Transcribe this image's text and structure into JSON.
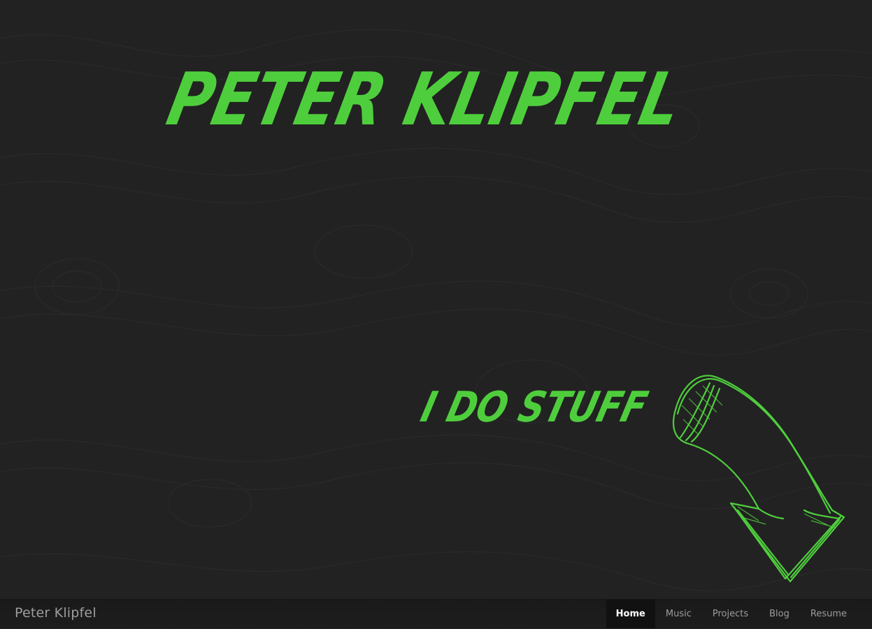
{
  "hero": {
    "title": "PETER KLIPFEL",
    "tagline": "I DO STUFF"
  },
  "colors": {
    "accent": "#4fce3d",
    "background": "#222222",
    "navbar": "#1b1b1b",
    "nav_text": "#9d9d9d",
    "nav_active_text": "#ffffff"
  },
  "icons": {
    "arrow": "hand-drawn-curved-arrow-down"
  },
  "navbar": {
    "brand": "Peter Klipfel",
    "links": [
      {
        "label": "Home",
        "active": true
      },
      {
        "label": "Music",
        "active": false
      },
      {
        "label": "Projects",
        "active": false
      },
      {
        "label": "Blog",
        "active": false
      },
      {
        "label": "Resume",
        "active": false
      }
    ]
  }
}
